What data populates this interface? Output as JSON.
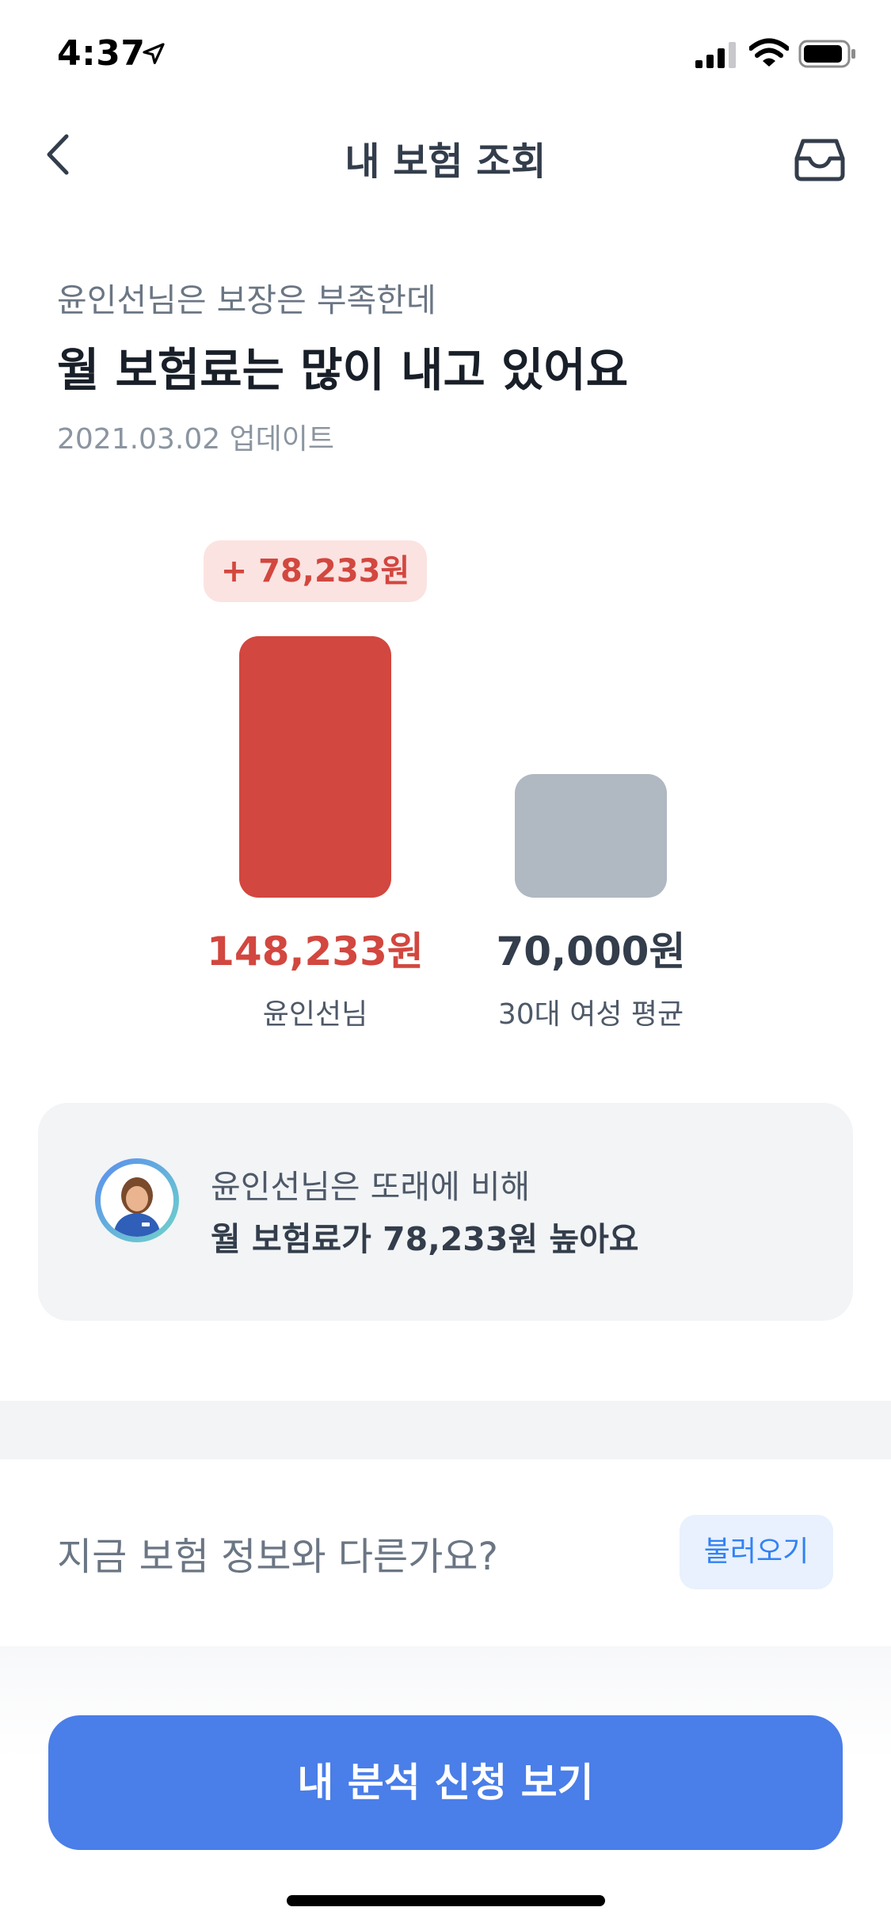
{
  "status_bar": {
    "time": "4:37",
    "icons": [
      "location-arrow-icon",
      "cellular-signal-icon",
      "wifi-icon",
      "battery-icon"
    ]
  },
  "nav": {
    "title": "내 보험 조회",
    "back_icon": "chevron-left-icon",
    "inbox_icon": "inbox-tray-icon"
  },
  "header": {
    "subtitle": "윤인선님은 보장은 부족한데",
    "headline": "월 보험료는 많이 내고 있어요",
    "updated": "2021.03.02 업데이트"
  },
  "chart_data": {
    "type": "bar",
    "categories": [
      "윤인선님",
      "30대 여성 평균"
    ],
    "values": [
      148233,
      70000
    ],
    "value_labels": [
      "148,233원",
      "70,000원"
    ],
    "difference_label": "+ 78,233원",
    "colors": [
      "#d2473f",
      "#b0b8c1"
    ],
    "grid": false
  },
  "compare_card": {
    "line1": "윤인선님은 또래에 비해",
    "line2": "월 보험료가 78,233원 높아요",
    "avatar_icon": "user-avatar-icon"
  },
  "question": {
    "text": "지금 보험 정보와 다른가요?",
    "button_label": "불러오기"
  },
  "cta": {
    "label": "내 분석 신청 보기"
  },
  "colors": {
    "accent": "#4a7ee8",
    "danger": "#d2473f",
    "muted_bar": "#b0b8c1",
    "card_bg": "#f2f4f6"
  }
}
